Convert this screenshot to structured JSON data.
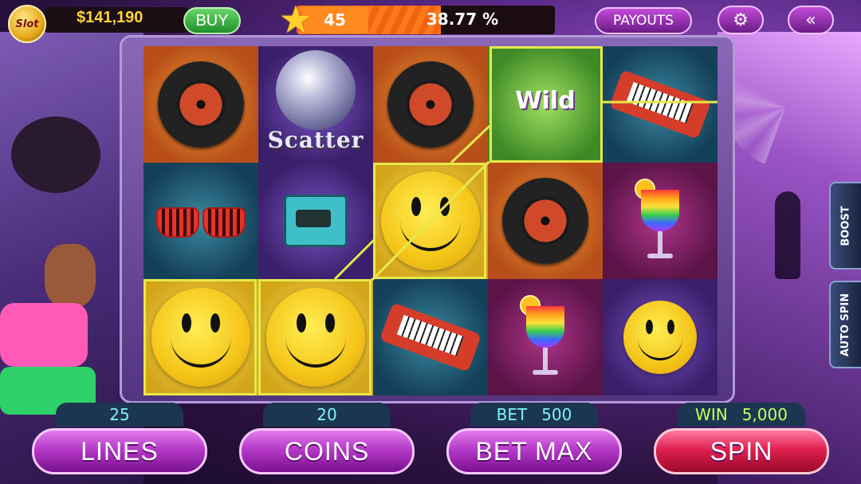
{
  "top_bar": {
    "logo_text": "Slot",
    "balance": "$141,190",
    "buy_label": "BUY",
    "level": "45",
    "xp_percent": "38.77 %",
    "xp_fraction": 0.3877,
    "payouts_label": "PAYOUTS",
    "settings_icon": "gear-icon",
    "back_icon": "double-chevron-left-icon"
  },
  "reels": {
    "symbol_scatter": "Scatter",
    "symbol_wild": "Wild"
  },
  "side_tabs": {
    "boost": "BOOST",
    "auto_spin": "AUTO SPIN"
  },
  "bottom": {
    "lines_value": "25",
    "lines_label": "LINES",
    "coins_value": "20",
    "coins_label": "COINS",
    "bet_label": "BET",
    "bet_value": "500",
    "bet_max_label": "BET MAX",
    "win_label": "WIN",
    "win_value": "5,000",
    "spin_label": "SPIN"
  },
  "colors": {
    "accent_purple": "#b43ac8",
    "spin_red": "#e02050",
    "win_highlight": "#e8e84a",
    "balance_gold": "#ffd23a"
  }
}
